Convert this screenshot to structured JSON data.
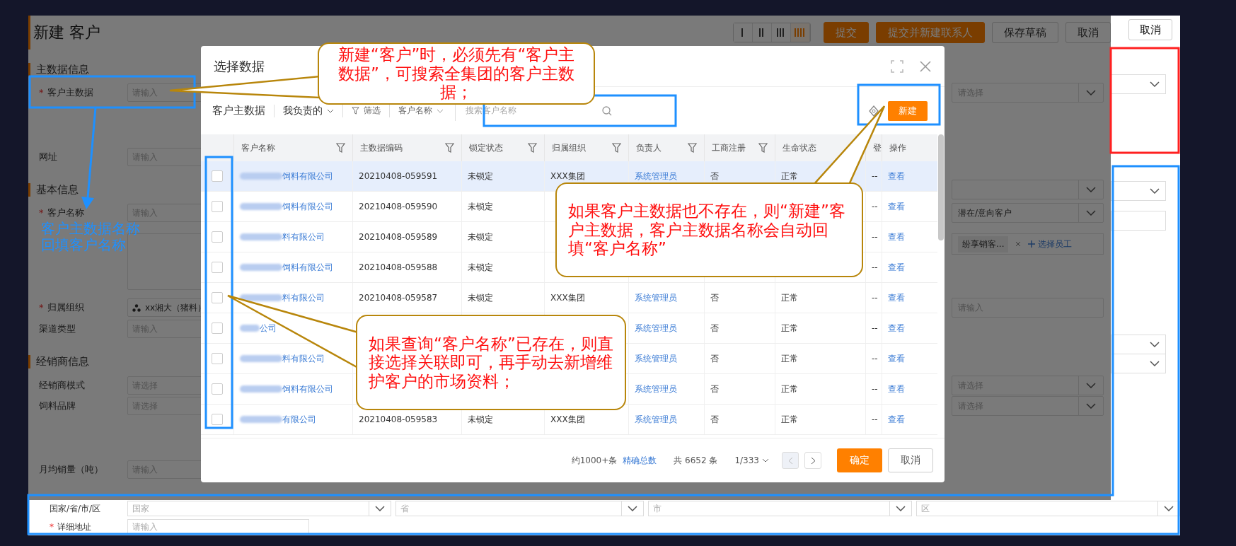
{
  "form": {
    "title": "新建 客户",
    "view_toggle": [
      {
        "selected": false
      },
      {
        "selected": false
      },
      {
        "selected": false
      },
      {
        "selected": true
      }
    ],
    "actions": [
      {
        "label": "提交",
        "kind": "primary"
      },
      {
        "label": "提交并新建联系人",
        "kind": "primary"
      },
      {
        "label": "保存草稿",
        "kind": "default"
      },
      {
        "label": "取消",
        "kind": "default"
      }
    ],
    "rows": [
      {
        "kind": "section",
        "label": "主数据信息"
      },
      {
        "kind": "input",
        "label": "客户主数据",
        "marker": "*",
        "placeholder": "请输入",
        "right": {
          "kind": "select",
          "placeholder": "请选择"
        }
      },
      {
        "kind": "input",
        "label": "网址",
        "placeholder": "请输入"
      },
      {
        "kind": "section",
        "label": "基本信息",
        "right": {
          "kind": "select"
        }
      },
      {
        "kind": "input",
        "label": "客户名称",
        "marker": "*",
        "placeholder": "请输入",
        "right": {
          "kind": "select",
          "value": "潜在/意向客户"
        }
      },
      {
        "kind": "textarea",
        "right": {
          "kind": "tags",
          "tag": "纷享销客...",
          "action": "选择员工"
        }
      },
      {
        "kind": "org",
        "label": "归属组织",
        "marker": "*",
        "value": "xx湘大（猪料）",
        "right": {
          "kind": "input",
          "placeholder": "请输入"
        }
      },
      {
        "kind": "input",
        "label": "渠道类型",
        "placeholder": "请输入"
      },
      {
        "kind": "section",
        "label": "经销商信息"
      },
      {
        "kind": "select",
        "label": "经销商模式",
        "placeholder": "请选择",
        "right": {
          "kind": "select",
          "placeholder": "请选择"
        }
      },
      {
        "kind": "select",
        "label": "饲料品牌",
        "placeholder": "请选择",
        "right": {
          "kind": "select",
          "placeholder": "请选择"
        }
      },
      {
        "kind": "input",
        "label": "月均销量（吨）",
        "placeholder": "请输入"
      }
    ],
    "side": {
      "button": "取消",
      "fields": [
        {
          "kind": "select"
        },
        {
          "kind": "select"
        },
        {
          "kind": "input"
        },
        {
          "kind": "select"
        },
        {
          "kind": "select"
        }
      ]
    },
    "address": {
      "label": "国家/省/市/区",
      "selects": [
        "国家",
        "省",
        "市",
        "区"
      ],
      "detail_label": "详细地址",
      "detail_marker": "*",
      "detail_placeholder": "请输入"
    }
  },
  "dialog": {
    "title": "选择数据",
    "toolbar": {
      "scope": "客户主数据",
      "mine": "我负责的",
      "filter": "筛选",
      "field": "客户名称",
      "search_placeholder": "搜索客户名称",
      "new_button": "新建"
    },
    "columns": [
      {
        "label": "客户名称",
        "filterable": true
      },
      {
        "label": "主数据编码",
        "filterable": true
      },
      {
        "label": "锁定状态",
        "filterable": true
      },
      {
        "label": "归属组织",
        "filterable": true
      },
      {
        "label": "负责人",
        "filterable": true
      },
      {
        "label": "工商注册",
        "filterable": true
      },
      {
        "label": "生命状态",
        "filterable": false
      },
      {
        "label": "登",
        "filterable": false
      },
      {
        "label": "操作",
        "filterable": false
      }
    ],
    "rows": [
      {
        "highlighted": true,
        "checked": false,
        "cells": [
          "饲料有限公司",
          "20210408-059591",
          "未锁定",
          "XXX集团",
          "系统管理员",
          "否",
          "正常",
          "--",
          "查看"
        ]
      },
      {
        "highlighted": false,
        "checked": false,
        "cells": [
          "饲料有限公司",
          "20210408-059590",
          "未锁定",
          null,
          null,
          null,
          null,
          "--",
          "查看"
        ]
      },
      {
        "highlighted": false,
        "checked": false,
        "cells": [
          "料有限公司",
          "20210408-059589",
          "未锁定",
          null,
          null,
          null,
          null,
          "--",
          "查看"
        ]
      },
      {
        "highlighted": false,
        "checked": false,
        "cells": [
          "饲料有限公司",
          "20210408-059588",
          "未锁定",
          null,
          null,
          null,
          null,
          "--",
          "查看"
        ]
      },
      {
        "highlighted": false,
        "checked": false,
        "cells": [
          "料有限公司",
          "20210408-059587",
          "未锁定",
          "XXX集团",
          "系统管理员",
          "否",
          "正常",
          "--",
          "查看"
        ]
      },
      {
        "highlighted": false,
        "checked": false,
        "cells": [
          "公司",
          null,
          null,
          null,
          "系统管理员",
          "否",
          "正常",
          "--",
          "查看"
        ]
      },
      {
        "highlighted": false,
        "checked": false,
        "cells": [
          "料有限公司",
          null,
          null,
          null,
          "系统管理员",
          "否",
          "正常",
          "--",
          "查看"
        ]
      },
      {
        "highlighted": false,
        "checked": false,
        "cells": [
          "饲料有限公司",
          null,
          null,
          null,
          "系统管理员",
          "否",
          "正常",
          "--",
          "查看"
        ]
      },
      {
        "highlighted": false,
        "checked": false,
        "cells": [
          "有限公司",
          "20210408-059583",
          "未锁定",
          "XXX集团",
          "系统管理员",
          "否",
          "正常",
          "--",
          "查看"
        ]
      }
    ],
    "footer": {
      "approx": "约1000+条",
      "exact_link": "精确总数",
      "total": "共 6652 条",
      "page": "1/333",
      "prev_disabled": true,
      "next_disabled": false,
      "ok": "确定",
      "cancel": "取消"
    }
  },
  "annotations": {
    "callouts": [
      "新建“客户”时，必须先有“客户主数据”，可搜索全集团的客户主数据；",
      "如果客户主数据也不存在，则“新建”客户主数据，客户主数据名称会自动回填“客户名称”",
      "如果查询“客户名称”已存在，则直接选择关联即可，再手动去新增维护客户的市场资料；"
    ],
    "note": "客户主数据名称回填客户名称"
  }
}
